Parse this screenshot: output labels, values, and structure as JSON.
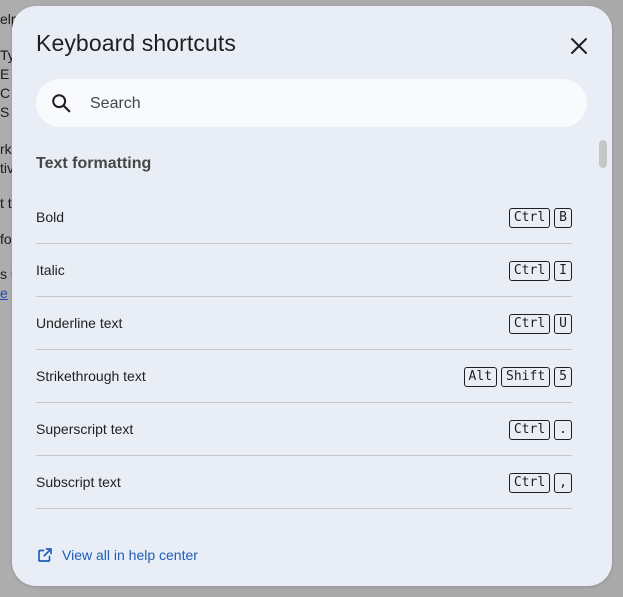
{
  "background_document": {
    "fragments": [
      "elp",
      "Ty",
      "E",
      "C",
      "S",
      "rk",
      "tiv",
      "t t",
      "fo",
      "s u",
      "e"
    ]
  },
  "dialog": {
    "title": "Keyboard shortcuts",
    "close_icon": "close-icon",
    "search": {
      "placeholder": "Search",
      "value": "",
      "icon": "search-icon"
    },
    "sections": [
      {
        "heading": "Text formatting",
        "shortcuts": [
          {
            "label": "Bold",
            "keys": [
              "Ctrl",
              "B"
            ]
          },
          {
            "label": "Italic",
            "keys": [
              "Ctrl",
              "I"
            ]
          },
          {
            "label": "Underline text",
            "keys": [
              "Ctrl",
              "U"
            ]
          },
          {
            "label": "Strikethrough text",
            "keys": [
              "Alt",
              "Shift",
              "5"
            ]
          },
          {
            "label": "Superscript text",
            "keys": [
              "Ctrl",
              "."
            ]
          },
          {
            "label": "Subscript text",
            "keys": [
              "Ctrl",
              ","
            ]
          }
        ]
      }
    ],
    "help_link": {
      "label": "View all in help center",
      "icon": "open-in-new-icon"
    }
  },
  "colors": {
    "dialog_bg": "#e9eef6",
    "search_bg": "#f8fafd",
    "link": "#1f5bb8",
    "divider": "#c4c7c5"
  }
}
